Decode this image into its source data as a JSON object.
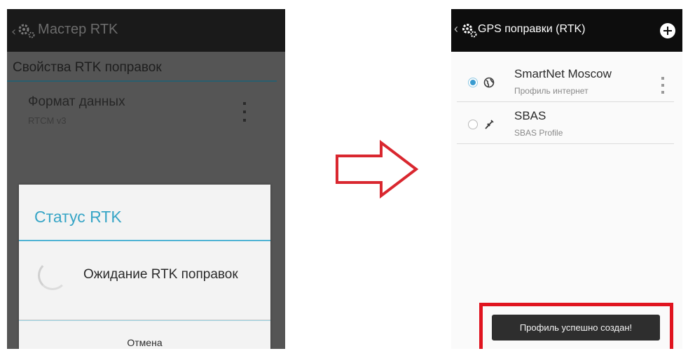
{
  "left_screen": {
    "title": "Мастер RTK",
    "section_title": "Свойства RTK поправок",
    "setting": {
      "title": "Формат данных",
      "value": "RTCM v3"
    },
    "dialog": {
      "title": "Статус RTK",
      "message": "Ожидание RTK поправок",
      "cancel_label": "Отмена"
    }
  },
  "right_screen": {
    "back_glyph": "‹",
    "title": "GPS поправки (RTK)",
    "profiles": [
      {
        "name": "SmartNet Moscow",
        "subtitle": "Профиль интернет",
        "selected": true,
        "icon": "globe-icon"
      },
      {
        "name": "SBAS",
        "subtitle": "SBAS Profile",
        "selected": false,
        "icon": "satellite-icon"
      }
    ],
    "toast": "Профиль успешно создан!"
  },
  "colors": {
    "accent": "#37a5c6",
    "highlight": "#e0141f",
    "radio_selected": "#3a9bd0"
  }
}
